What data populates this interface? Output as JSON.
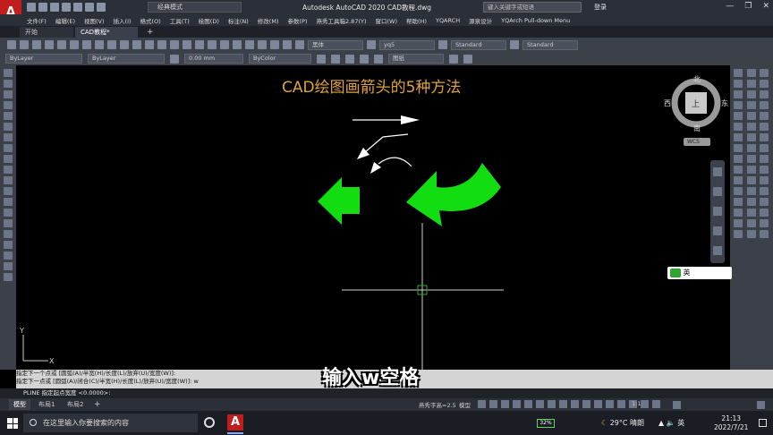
{
  "app": {
    "window_title": "Autodesk AutoCAD 2020    CAD教程.dwg",
    "logo": "A",
    "workspace": "经典模式",
    "search_placeholder": "键入关键字或短语",
    "login_label": "登录",
    "window_controls": [
      "minimize-icon",
      "restore-icon",
      "close-icon"
    ]
  },
  "menu": [
    "文件(F)",
    "编辑(E)",
    "视图(V)",
    "插入(I)",
    "格式(O)",
    "工具(T)",
    "绘图(D)",
    "标注(N)",
    "修改(M)",
    "参数(P)",
    "燕秀工具箱2.87(Y)",
    "窗口(W)",
    "帮助(H)",
    "YQARCH",
    "源泉设计",
    "YQArch Pull-down Menu"
  ],
  "tabs": {
    "start": "开始",
    "current": "CAD教程*"
  },
  "toolbar": {
    "font_style": "黑体",
    "dim_style": "yq5",
    "table_style": "Standard",
    "mleader_style": "Standard",
    "layer": "ByLayer",
    "linetype": "ByLayer",
    "lineweight": "0.00 mm",
    "plotstyle": "ByColor",
    "layer_state": "图纸"
  },
  "viewcube": {
    "north": "北",
    "south": "南",
    "east": "东",
    "west": "西",
    "top": "上",
    "wcs": "WCS"
  },
  "drawing": {
    "title": "CAD绘图画箭头的5种方法",
    "accent_color": "#00e000",
    "title_color": "#e0a33a"
  },
  "ime": {
    "label": "英"
  },
  "command": {
    "history": [
      "指定下一个点或 [圆弧(A)/半宽(H)/长度(L)/放弃(U)/宽度(W)]:",
      "指定下一点或 [圆弧(A)/闭合(C)/半宽(H)/长度(L)/放弃(U)/宽度(W)]: w"
    ],
    "prompt": "PLINE 指定起点宽度 <0.0000>:"
  },
  "caption": "输入w空格",
  "status": {
    "model_tab": "模型",
    "layout1": "布局1",
    "layout2": "布局2",
    "anno_scale": "燕秀字高=2.5",
    "mode": "模型",
    "scale": "1:1"
  },
  "taskbar": {
    "search_placeholder": "在这里输入你要搜索的内容",
    "battery": "32%",
    "weather": "29°C 晴朗",
    "ime": "英",
    "time": "21:13",
    "date": "2022/7/21"
  }
}
